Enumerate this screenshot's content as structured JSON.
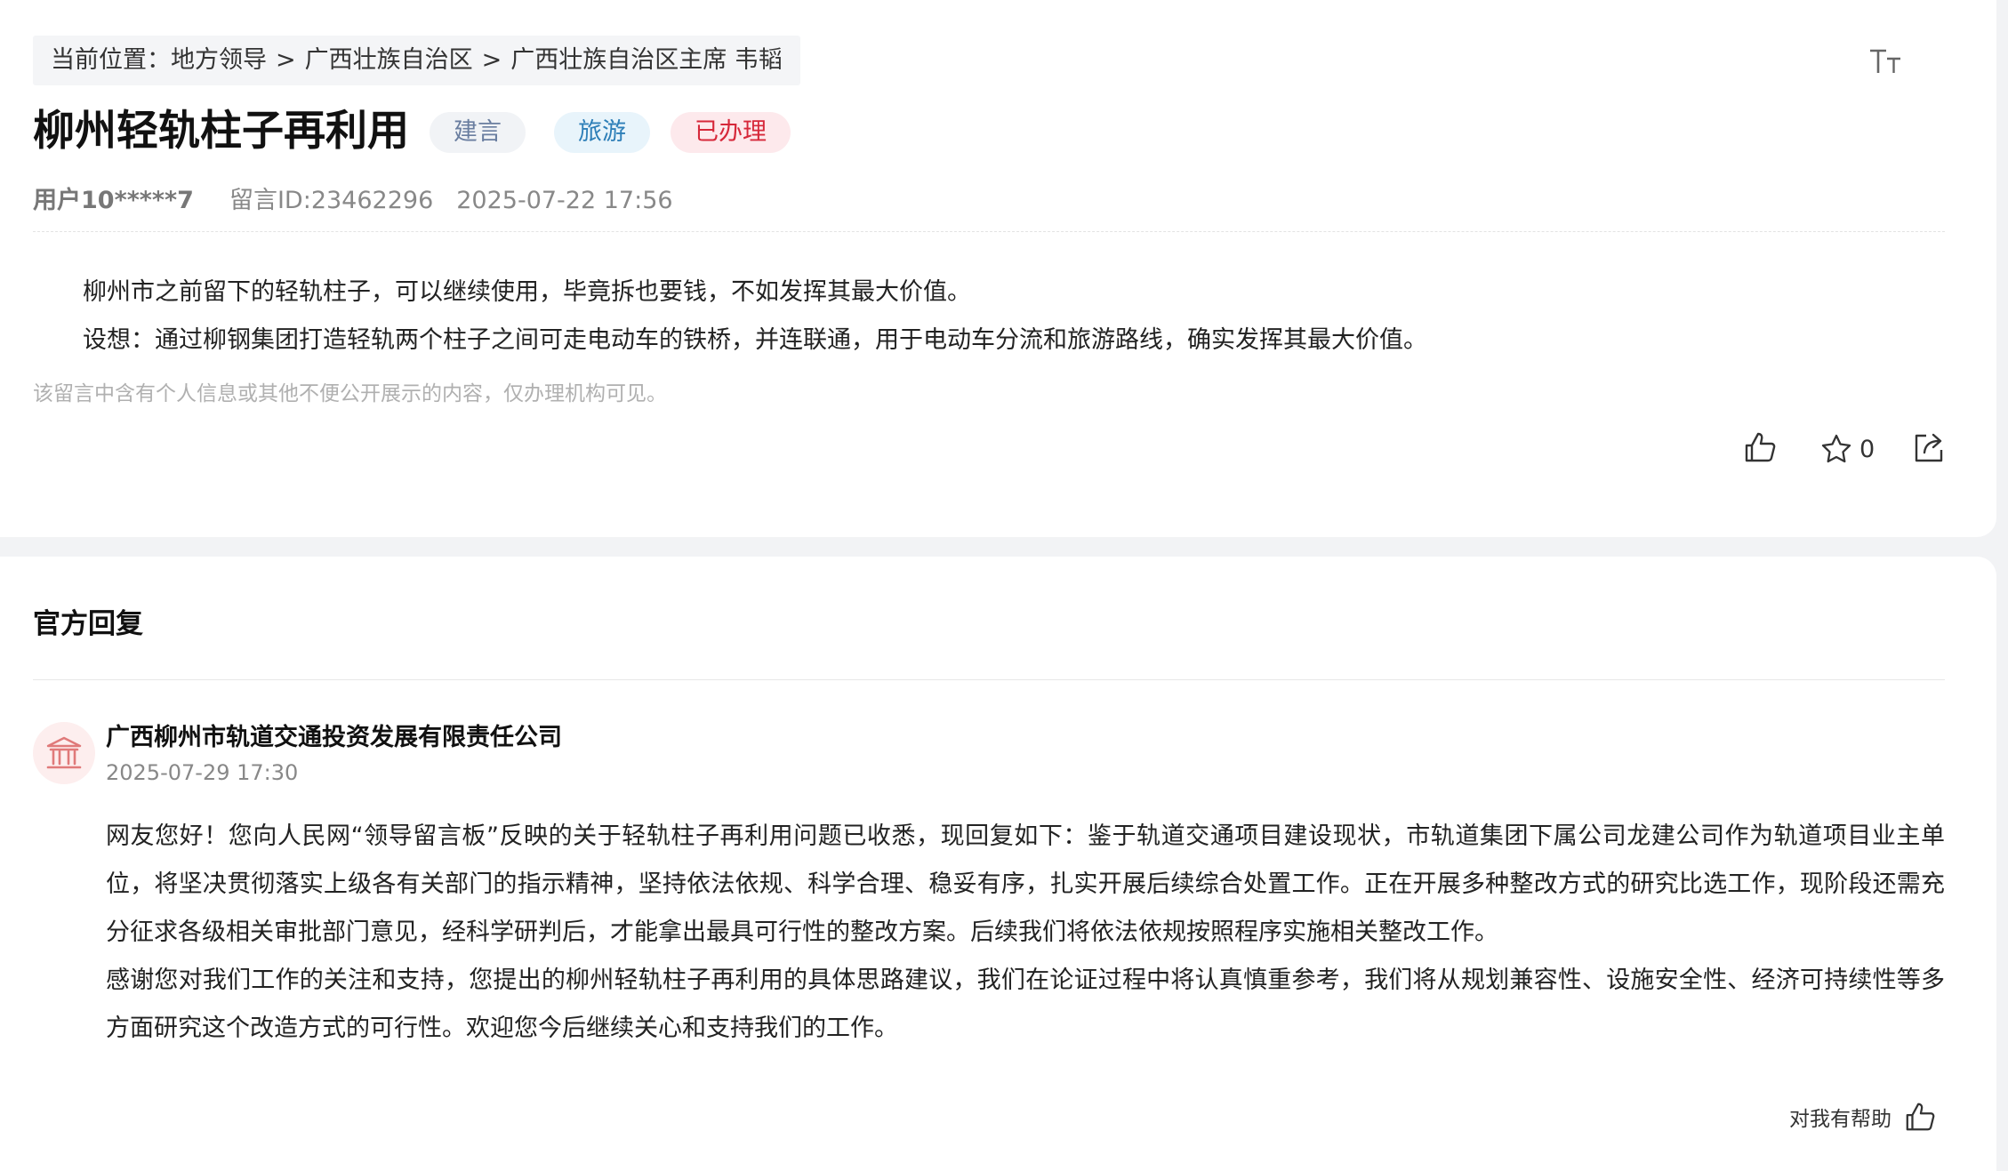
{
  "breadcrumb": {
    "prefix": "当前位置：",
    "items": [
      "地方领导",
      "广西壮族自治区",
      "广西壮族自治区主席 韦韬"
    ],
    "separator": ">"
  },
  "post": {
    "title": "柳州轻轨柱子再利用",
    "tags": [
      "建言",
      "旅游",
      "已办理"
    ],
    "user": "用户10*****7",
    "message_id": "留言ID:23462296",
    "datetime": "2025-07-22 17:56",
    "paragraphs": [
      "柳州市之前留下的轻轨柱子，可以继续使用，毕竟拆也要钱，不如发挥其最大价值。",
      "设想：通过柳钢集团打造轻轨两个柱子之间可走电动车的铁桥，并连联通，用于电动车分流和旅游路线，确实发挥其最大价值。"
    ],
    "hidden_note": "该留言中含有个人信息或其他不便公开展示的内容，仅办理机构可见。",
    "favorite_count": "0"
  },
  "reply": {
    "section_title": "官方回复",
    "org_name": "广西柳州市轨道交通投资发展有限责任公司",
    "datetime": "2025-07-29 17:30",
    "paragraphs": [
      "网友您好！您向人民网“领导留言板”反映的关于轻轨柱子再利用问题已收悉，现回复如下：鉴于轨道交通项目建设现状，市轨道集团下属公司龙建公司作为轨道项目业主单位，将坚决贯彻落实上级各有关部门的指示精神，坚持依法依规、科学合理、稳妥有序，扎实开展后续综合处置工作。正在开展多种整改方式的研究比选工作，现阶段还需充分征求各级相关审批部门意见，经科学研判后，才能拿出最具可行性的整改方案。后续我们将依法依规按照程序实施相关整改工作。",
      "感谢您对我们工作的关注和支持，您提出的柳州轻轨柱子再利用的具体思路建议，我们在论证过程中将认真慎重参考，我们将从规划兼容性、设施安全性、经济可持续性等多方面研究这个改造方式的可行性。欢迎您今后继续关心和支持我们的工作。"
    ],
    "helpful_label": "对我有帮助"
  },
  "icons": {
    "font_size": "font-size-icon",
    "like": "thumbs-up-icon",
    "favorite": "star-icon",
    "share": "share-icon",
    "org_avatar": "government-building-icon"
  },
  "colors": {
    "tag_suggest": "#6a7ea0",
    "tag_travel": "#2e7fb8",
    "tag_done": "#d6283a",
    "avatar_icon": "#e07a7a"
  }
}
